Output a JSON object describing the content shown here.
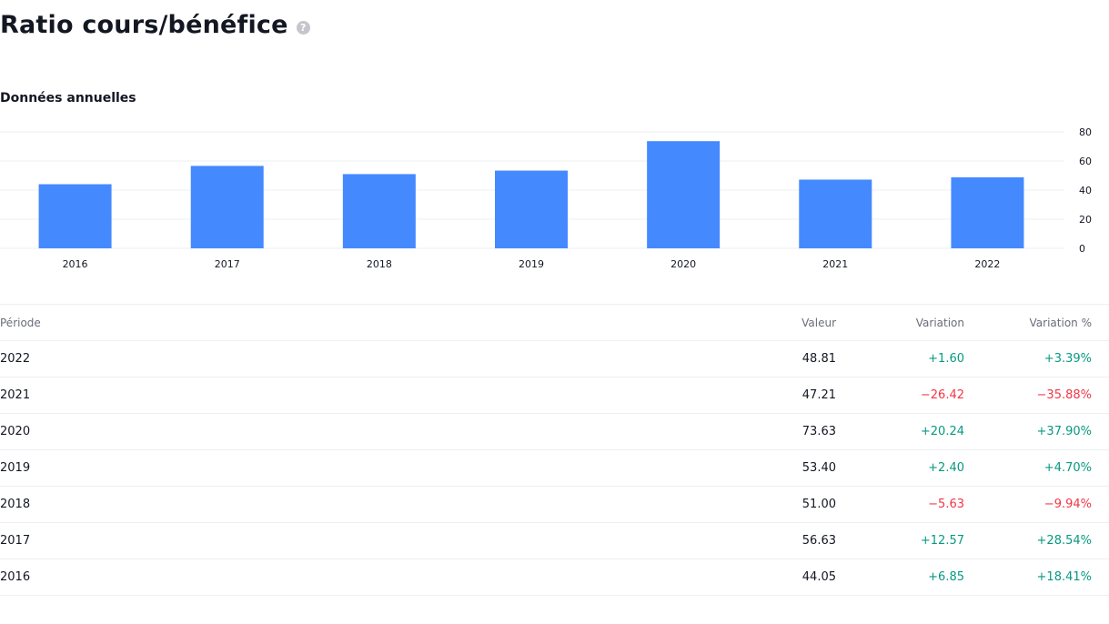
{
  "page": {
    "title": "Ratio cours/bénéfice",
    "help_icon": "question-icon"
  },
  "section": {
    "title": "Données annuelles"
  },
  "colors": {
    "bar": "#4589ff",
    "positive": "#089981",
    "negative": "#f23645",
    "grid": "#eeeff2"
  },
  "chart_data": {
    "type": "bar",
    "categories": [
      "2016",
      "2017",
      "2018",
      "2019",
      "2020",
      "2021",
      "2022"
    ],
    "values": [
      44.05,
      56.63,
      51.0,
      53.4,
      73.63,
      47.21,
      48.81
    ],
    "title": "",
    "xlabel": "",
    "ylabel": "",
    "ylim": [
      0,
      80
    ],
    "yticks": [
      "0",
      "20",
      "40",
      "60",
      "80"
    ],
    "grid": true,
    "y_axis_side": "right"
  },
  "table": {
    "headers": {
      "period": "Période",
      "value": "Valeur",
      "change": "Variation",
      "change_pct": "Variation %"
    },
    "rows": [
      {
        "period": "2022",
        "value": "48.81",
        "change": "+1.60",
        "change_pct": "+3.39%",
        "trend": "pos"
      },
      {
        "period": "2021",
        "value": "47.21",
        "change": "−26.42",
        "change_pct": "−35.88%",
        "trend": "neg"
      },
      {
        "period": "2020",
        "value": "73.63",
        "change": "+20.24",
        "change_pct": "+37.90%",
        "trend": "pos"
      },
      {
        "period": "2019",
        "value": "53.40",
        "change": "+2.40",
        "change_pct": "+4.70%",
        "trend": "pos"
      },
      {
        "period": "2018",
        "value": "51.00",
        "change": "−5.63",
        "change_pct": "−9.94%",
        "trend": "neg"
      },
      {
        "period": "2017",
        "value": "56.63",
        "change": "+12.57",
        "change_pct": "+28.54%",
        "trend": "pos"
      },
      {
        "period": "2016",
        "value": "44.05",
        "change": "+6.85",
        "change_pct": "+18.41%",
        "trend": "pos"
      }
    ]
  }
}
